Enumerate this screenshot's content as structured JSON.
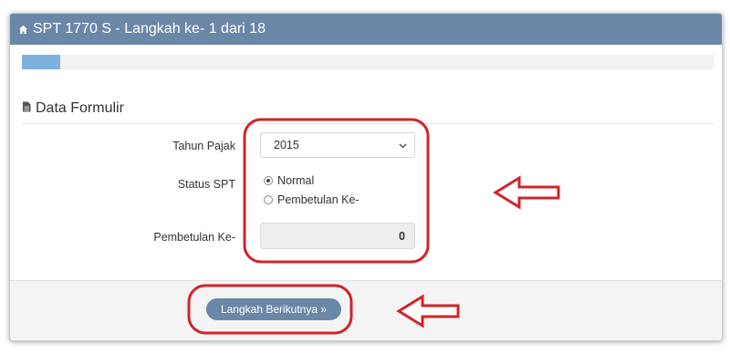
{
  "header": {
    "title": "SPT 1770 S - Langkah ke- 1 dari 18",
    "icon": "home-icon"
  },
  "progress": {
    "step": 1,
    "total": 18,
    "fraction": 0.055
  },
  "section": {
    "title": "Data Formulir",
    "icon": "document-icon"
  },
  "form": {
    "tahun_pajak": {
      "label": "Tahun Pajak",
      "value": "2015"
    },
    "status_spt": {
      "label": "Status SPT",
      "options": [
        {
          "label": "Normal",
          "checked": true
        },
        {
          "label": "Pembetulan Ke-",
          "checked": false
        }
      ]
    },
    "pembetulan": {
      "label": "Pembetulan Ke-",
      "value": "0"
    }
  },
  "footer": {
    "next_label": "Langkah Berikutnya »"
  },
  "colors": {
    "primary": "#6b87a8",
    "progress_fill": "#7fb1df",
    "annotation": "#d0242b"
  }
}
